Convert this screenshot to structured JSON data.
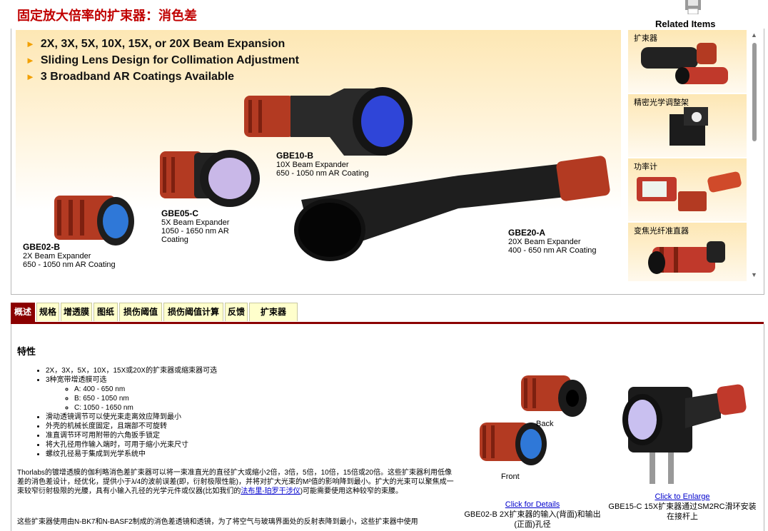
{
  "page": {
    "title": "固定放大倍率的扩束器：消色差",
    "related_title": "Related Items"
  },
  "hero": {
    "bullets": [
      "2X, 3X, 5X, 10X, 15X, or 20X Beam Expansion",
      "Sliding Lens Design for Collimation Adjustment",
      "3 Broadband AR Coatings Available"
    ],
    "products": [
      {
        "part": "GBE02-B",
        "desc1": "2X Beam Expander",
        "desc2": "650 - 1050 nm AR Coating",
        "desc3": ""
      },
      {
        "part": "GBE05-C",
        "desc1": "5X Beam Expander",
        "desc2": "1050 - 1650 nm AR",
        "desc3": "Coating"
      },
      {
        "part": "GBE10-B",
        "desc1": "10X Beam Expander",
        "desc2": "650 - 1050 nm AR Coating",
        "desc3": ""
      },
      {
        "part": "GBE20-A",
        "desc1": "20X Beam Expander",
        "desc2": "400 - 650 nm AR Coating",
        "desc3": ""
      }
    ]
  },
  "related": {
    "items": [
      "扩束器",
      "精密光学调整架",
      "功率计",
      "变焦光纤准直器"
    ]
  },
  "tabs": [
    "概述",
    "规格",
    "增透膜",
    "图纸",
    "损伤阈值",
    "损伤阈值计算",
    "反馈",
    "扩束器"
  ],
  "overview": {
    "heading": "特性",
    "features": [
      "2X，3X，5X，10X，15X或20X的扩束器或缩束器可选",
      "3种宽带增透膜可选",
      "滑动透镜调节可以使光束走离效应降到最小",
      "外壳的机械长度固定，且端部不可旋转",
      "准直调节环可用附带的六角扳手锁定",
      "将大孔径用作输入端时，可用于缩小光束尺寸",
      "螺纹孔径易于集成到光学系统中"
    ],
    "coatings": [
      "A: 400 - 650 nm",
      "B: 650 - 1050 nm",
      "C: 1050 - 1650 nm"
    ],
    "para_before_link": "Thorlabs的镀增透膜的伽利略消色差扩束器可以将一束准直光的直径扩大或缩小2倍，3倍，5倍，10倍，15倍或20倍。这些扩束器利用低像差的消色差设计，经优化，提供小于λ/4的波前误差(即，衍射极限性能)，并将对扩大光束的M²值的影响降到最小。扩大的光束可以聚焦成一束较窄衍射极限的光腰，具有小输入孔径的光学元件或仪器(比如我们的",
    "link_text": "法布里-珀罗干涉仪",
    "para_after_link": ")可能需要使用这种较窄的束腰。",
    "para2": "这些扩束器使用由N-BK7和N-BASF2制成的消色差透镜和透镜，为了将空气与玻璃界面处的反射表降到最小，这些扩束器中使用"
  },
  "figures": {
    "back_label": "Back",
    "front_label": "Front",
    "click_details": "Click for Details",
    "caption1_line1": "GBE02-B 2X扩束器的输入(背面)和输出",
    "caption1_line2": "(正面)孔径",
    "click_enlarge": "Click to Enlarge",
    "caption2_line1": "GBE15-C 15X扩束器通过SM2RC滑环安装",
    "caption2_line2": "在接杆上"
  },
  "colors": {
    "accent": "#c00000",
    "tab_active": "#8b0000",
    "tab_bg": "#ffffcc",
    "lens_blue": "#2f45d8",
    "anodized_red": "#c0392b"
  }
}
